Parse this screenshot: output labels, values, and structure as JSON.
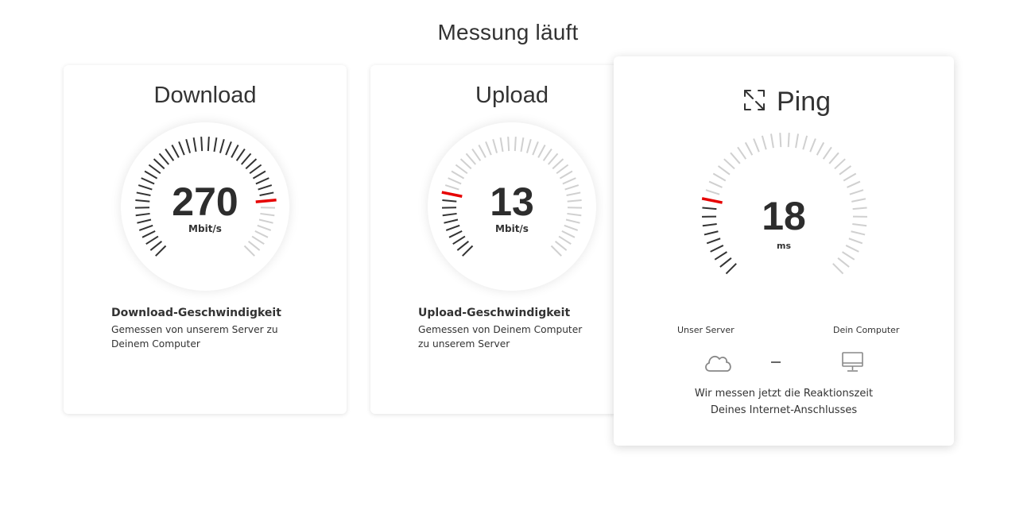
{
  "page": {
    "title": "Messung läuft"
  },
  "colors": {
    "accent": "#e60000",
    "tick_active": "#333333",
    "tick_inactive": "#d0d0d0"
  },
  "download": {
    "title": "Download",
    "value": "270",
    "unit": "Mbit/s",
    "progress": 0.82,
    "heading": "Download-Geschwindigkeit",
    "text": "Gemessen von unserem Server zu Deinem Computer"
  },
  "upload": {
    "title": "Upload",
    "value": "13",
    "unit": "Mbit/s",
    "progress": 0.22,
    "heading": "Upload-Geschwindigkeit",
    "text": "Gemessen von Deinem Computer zu unserem Server"
  },
  "ping": {
    "title": "Ping",
    "icon": "expand-arrows-icon",
    "value": "18",
    "unit": "ms",
    "progress": 0.22,
    "server_label": "Unser Server",
    "computer_label": "Dein Computer",
    "server_icon": "cloud-icon",
    "connection_icon": "dash-icon",
    "computer_icon": "monitor-icon",
    "footer_line1": "Wir messen jetzt die Reaktionszeit",
    "footer_line2": "Deines Internet-Anschlusses"
  }
}
